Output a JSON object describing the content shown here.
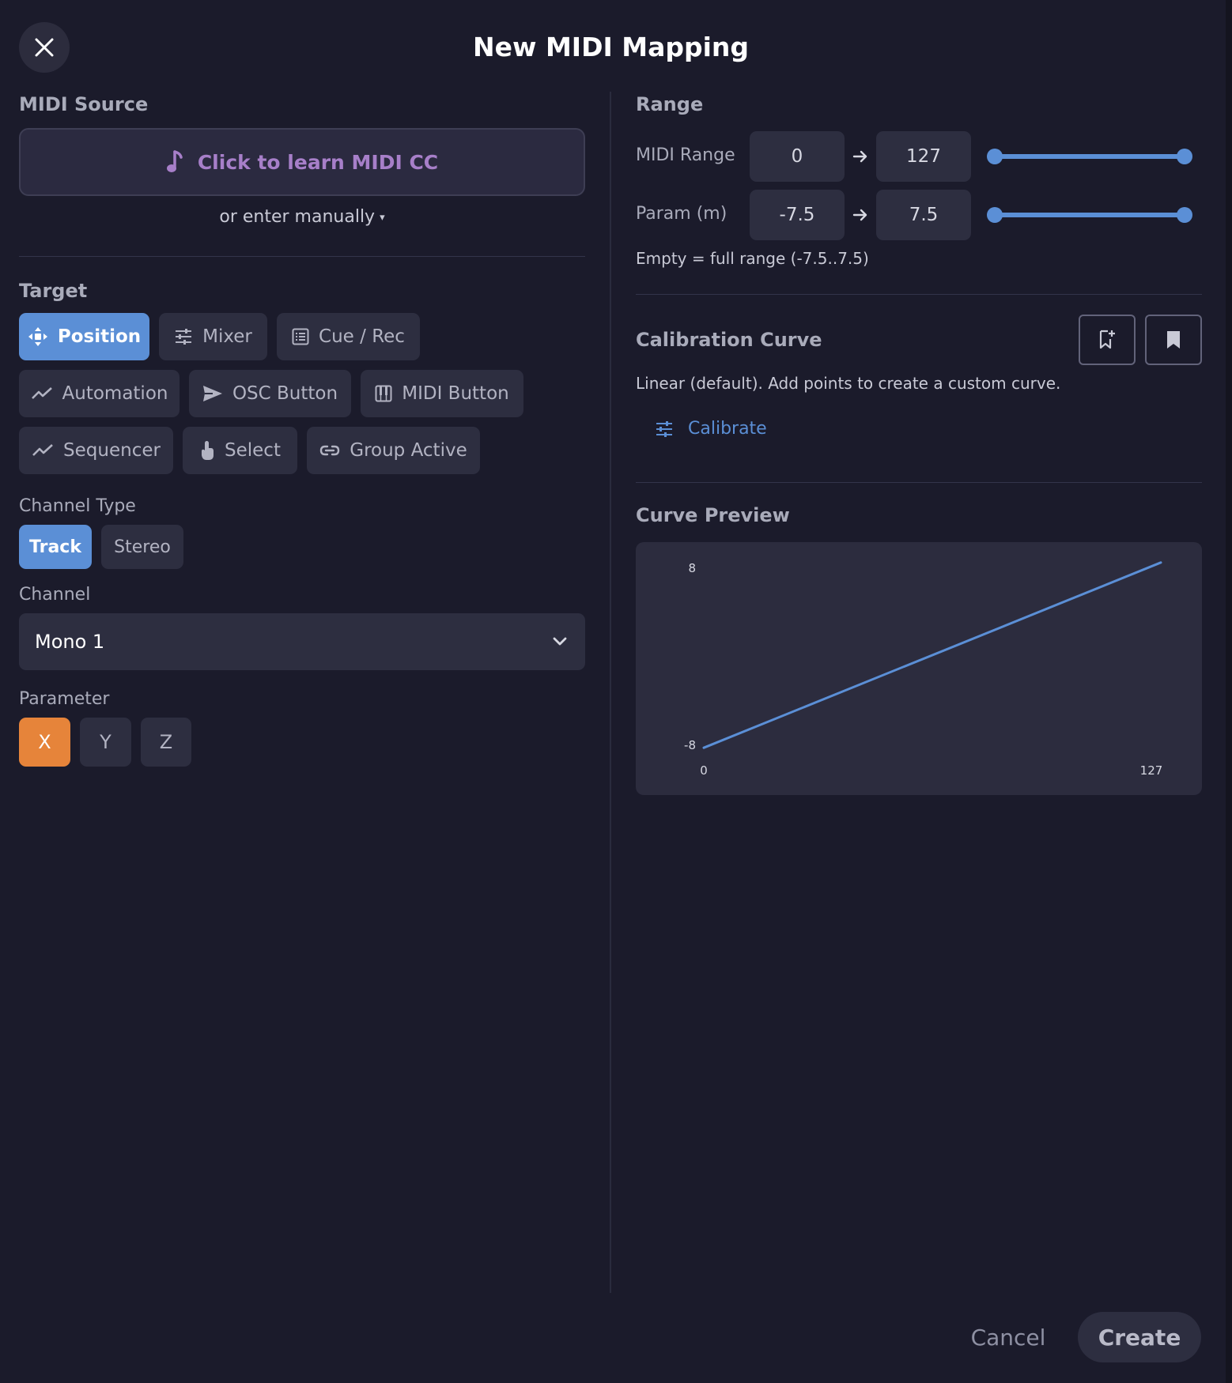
{
  "header": {
    "title": "New MIDI Mapping",
    "close_icon": "close-icon"
  },
  "midi_source": {
    "section_label": "MIDI Source",
    "learn_label": "Click to learn MIDI CC",
    "learn_icon": "music-note-icon",
    "manual_label": "or enter manually",
    "manual_caret": "▾"
  },
  "target": {
    "section_label": "Target",
    "selected": "Position",
    "options": [
      {
        "label": "Position",
        "icon": "move-icon"
      },
      {
        "label": "Mixer",
        "icon": "sliders-icon"
      },
      {
        "label": "Cue / Rec",
        "icon": "list-icon"
      },
      {
        "label": "Automation",
        "icon": "trend-icon"
      },
      {
        "label": "OSC Button",
        "icon": "send-icon"
      },
      {
        "label": "MIDI Button",
        "icon": "piano-icon"
      },
      {
        "label": "Sequencer",
        "icon": "trend-icon"
      },
      {
        "label": "Select",
        "icon": "touch-icon"
      },
      {
        "label": "Group Active",
        "icon": "link-icon"
      }
    ]
  },
  "channel_type": {
    "label": "Channel Type",
    "selected": "Track",
    "options": [
      "Track",
      "Stereo"
    ]
  },
  "channel": {
    "label": "Channel",
    "value": "Mono 1",
    "icon": "chevron-down-icon"
  },
  "parameter": {
    "label": "Parameter",
    "selected": "X",
    "options": [
      "X",
      "Y",
      "Z"
    ]
  },
  "range": {
    "section_label": "Range",
    "midi_range": {
      "label": "MIDI Range",
      "min": "0",
      "max": "127",
      "slider_min": 0,
      "slider_max": 127,
      "value_low": 0,
      "value_high": 127
    },
    "param_range": {
      "label": "Param (m)",
      "min": "-7.5",
      "max": "7.5",
      "slider_min": -7.5,
      "slider_max": 7.5,
      "value_low": -7.5,
      "value_high": 7.5
    },
    "hint": "Empty = full range (-7.5..7.5)"
  },
  "calibration": {
    "section_label": "Calibration Curve",
    "description": "Linear (default). Add points to create a custom curve.",
    "calibrate_label": "Calibrate",
    "calibrate_icon": "tune-icon",
    "save_preset_icon": "bookmark-add-icon",
    "load_preset_icon": "bookmark-icon"
  },
  "curve_preview": {
    "section_label": "Curve Preview"
  },
  "chart_data": {
    "type": "line",
    "title": "",
    "xlabel": "",
    "ylabel": "",
    "x_ticks": [
      "0",
      "127"
    ],
    "y_ticks": [
      "8",
      "-8"
    ],
    "xlim": [
      0,
      127
    ],
    "ylim": [
      -8,
      8
    ],
    "series": [
      {
        "x": [
          0,
          127
        ],
        "y": [
          -7.5,
          7.5
        ],
        "color": "#5b8fd6"
      }
    ]
  },
  "footer": {
    "cancel_label": "Cancel",
    "create_label": "Create"
  },
  "colors": {
    "background": "#1b1b2b",
    "accent": "#5b8fd6",
    "learn": "#a77fc9",
    "param_selected": "#e6843a"
  }
}
